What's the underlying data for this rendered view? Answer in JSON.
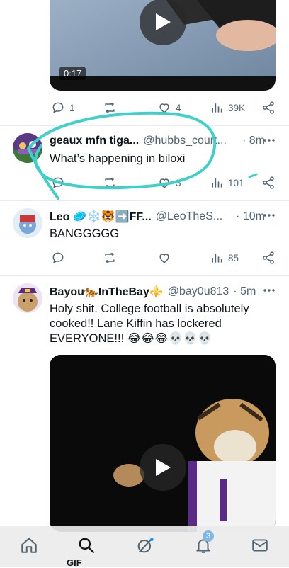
{
  "video_top": {
    "duration": "0:17"
  },
  "tweet1_actions": {
    "replies": "1",
    "likes": "4",
    "views": "39K"
  },
  "tweet2": {
    "name": "geaux mfn tiga...",
    "handle": "@hubbs_court...",
    "time": "· 8m",
    "text": "What’s happening in biloxi",
    "likes": "3",
    "views": "101"
  },
  "tweet3": {
    "name": "Leo 🥏❄️🐯➡️FF...",
    "handle": "@LeoTheS...",
    "time": "· 10m",
    "text": "BANGGGGG",
    "views": "85"
  },
  "tweet4": {
    "name": "Bayou🐅InTheBay⚜️",
    "handle": "@bay0u813",
    "time": "· 5m",
    "text_line1": "Holy shit. College football is absolutely",
    "text_line2": "cooked!! Lane Kiffin has lockered",
    "text_line3": "EVERYONE!!! 😂😂😂💀💀💀"
  },
  "bottom_nav": {
    "gif_label": "GIF",
    "notifications_badge": "3"
  },
  "colors": {
    "accent": "#1d9bf0",
    "annotation": "#3fd0c9",
    "text_muted": "#536471"
  }
}
